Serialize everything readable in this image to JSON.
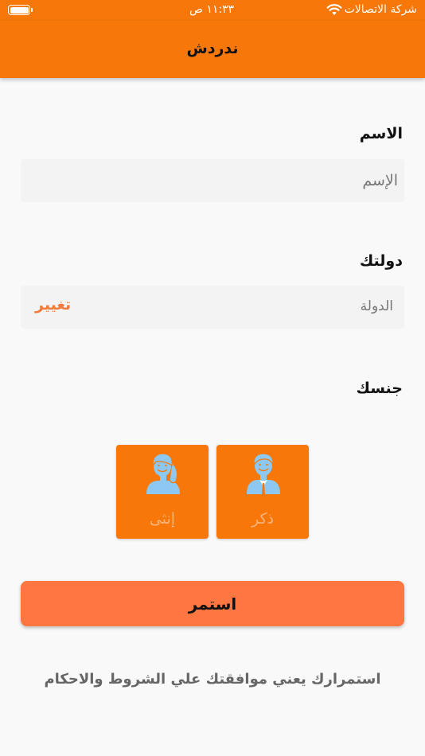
{
  "status_bar": {
    "carrier": "شركة الاتصالات",
    "time": "١١:٣٣ ص",
    "battery_level": 1.0
  },
  "header": {
    "title": "ندردش"
  },
  "form": {
    "name_label": "الاسم",
    "name_placeholder": "الإسم",
    "name_value": "",
    "country_label": "دولتك",
    "country_placeholder": "الدولة",
    "change_label": "تغيير",
    "gender_label": "جنسك"
  },
  "gender_options": [
    {
      "label": "ذكر",
      "icon": "male-avatar-icon"
    },
    {
      "label": "إنثى",
      "icon": "female-avatar-icon"
    }
  ],
  "continue_label": "استمر",
  "terms_text": "استمرارك يعني موافقتك علي الشروط والاحكام",
  "colors": {
    "primary": "#f77808",
    "button": "#ff7640",
    "accent_link": "#f47a3c",
    "avatar_blue": "#8cc8f2"
  }
}
